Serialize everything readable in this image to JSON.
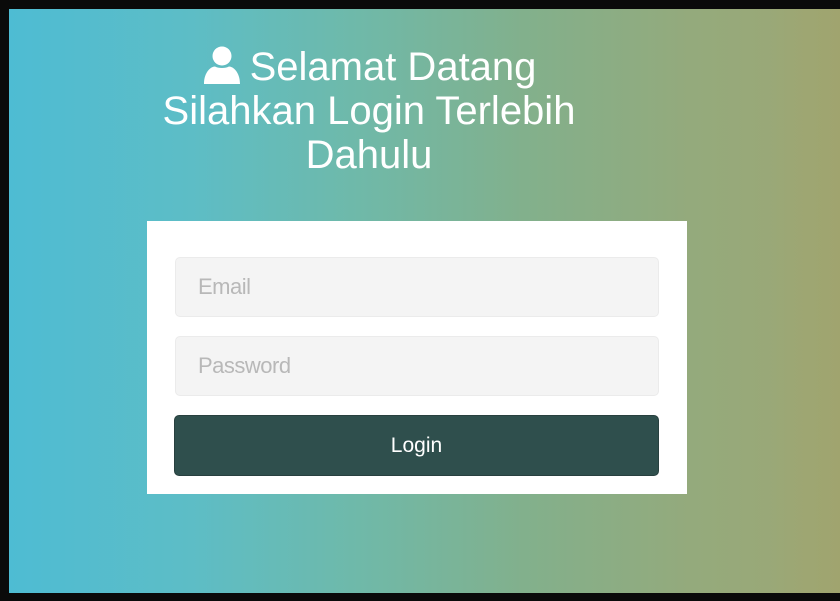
{
  "header": {
    "title_line1": "Selamat Datang",
    "title_line2": "Silahkan Login Terlebih",
    "title_line3": "Dahulu",
    "icon": "user-icon"
  },
  "form": {
    "email_placeholder": "Email",
    "email_value": "",
    "password_placeholder": "Password",
    "password_value": "",
    "login_label": "Login"
  },
  "colors": {
    "gradient_start": "#4ebcd3",
    "gradient_end": "#9ea774",
    "card_background": "#ffffff",
    "input_background": "#f4f4f4",
    "button_background": "#2f4f4d",
    "button_text": "#ffffff",
    "frame_border": "#0a0a0a"
  }
}
